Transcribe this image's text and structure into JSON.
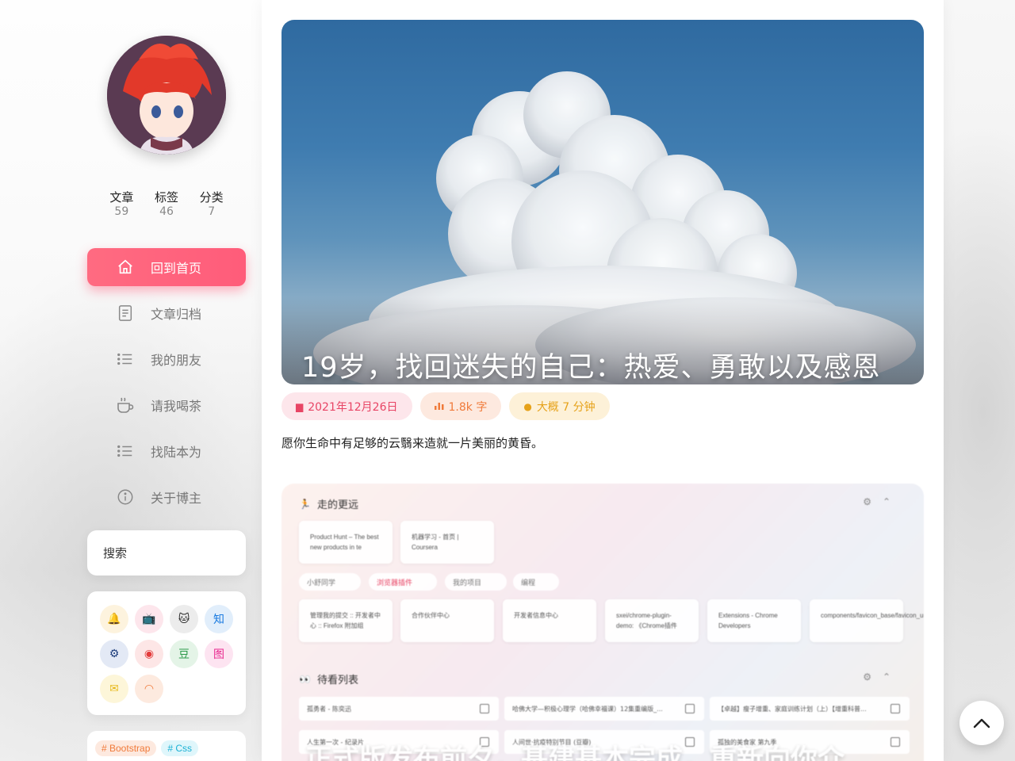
{
  "profile": {
    "stats": [
      {
        "label": "文章",
        "value": "59"
      },
      {
        "label": "标签",
        "value": "46"
      },
      {
        "label": "分类",
        "value": "7"
      }
    ]
  },
  "nav": {
    "items": [
      {
        "label": "回到首页",
        "icon": "home-icon",
        "active": true
      },
      {
        "label": "文章归档",
        "icon": "archive-icon"
      },
      {
        "label": "我的朋友",
        "icon": "list-icon"
      },
      {
        "label": "请我喝茶",
        "icon": "tea-cup-icon"
      },
      {
        "label": "找陆本为",
        "icon": "list-icon"
      },
      {
        "label": "关于博主",
        "icon": "info-icon"
      }
    ]
  },
  "search": {
    "placeholder": "搜索"
  },
  "social": [
    {
      "icon": "qq-bell-icon",
      "glyph": "🔔",
      "bg": "#fdf3de",
      "color": "#e6a21a"
    },
    {
      "icon": "bilibili-icon",
      "glyph": "📺",
      "bg": "#fde6ec",
      "color": "#f05a7e"
    },
    {
      "icon": "github-icon",
      "glyph": "🐱",
      "bg": "#ececec",
      "color": "#222"
    },
    {
      "icon": "zhihu-icon",
      "glyph": "知",
      "bg": "#e1eefb",
      "color": "#1a7be0"
    },
    {
      "icon": "steam-icon",
      "glyph": "⚙",
      "bg": "#e3e9f5",
      "color": "#1b3b7a"
    },
    {
      "icon": "weibo-icon",
      "glyph": "◉",
      "bg": "#fde6e6",
      "color": "#e33b3b"
    },
    {
      "icon": "douban-icon",
      "glyph": "豆",
      "bg": "#e4f4e7",
      "color": "#2c9a4a"
    },
    {
      "icon": "picture-icon",
      "glyph": "图",
      "bg": "#fde4f1",
      "color": "#e8288f"
    },
    {
      "icon": "ticket-icon",
      "glyph": "✉",
      "bg": "#fdf6d9",
      "color": "#e6b81a"
    },
    {
      "icon": "rss-icon",
      "glyph": "◠",
      "bg": "#fdeadf",
      "color": "#f07a3a"
    }
  ],
  "tags": [
    {
      "label": "# Bootstrap",
      "bg": "#fde9df",
      "color": "#f07a3a"
    },
    {
      "label": "# Css",
      "bg": "#dff6fb",
      "color": "#19b0d4"
    }
  ],
  "post1": {
    "title": "19岁，找回迷失的自己：热爱、勇敢以及感恩",
    "date": "2021年12月26日",
    "words": "1.8k 字",
    "read_time": "大概 7 分钟",
    "excerpt": "愿你生命中有足够的云翳来造就一片美丽的黄昏。"
  },
  "post2": {
    "title": "正式版发布前夕，基建基本完成，重新向你介",
    "section1": "走的更远",
    "section2": "待看列表",
    "tiles_top": [
      "Product Hunt – The best new products in te",
      "机器学习 - 首页 | Coursera"
    ],
    "pills": [
      "小舒同学",
      "浏览器插件",
      "我的项目",
      "编程"
    ],
    "tiles_mid": [
      "管理我的提交 :: 开发者中心 :: Firefox 附加组",
      "合作伙伴中心",
      "开发者信息中心",
      "sxei/chrome-plugin-demo: 《Chrome插件",
      "Extensions - Chrome Developers",
      "components/favicon_base/favicon_url_pars"
    ],
    "rows": [
      "孤勇者 - 陈奕迅",
      "哈佛大学—积极心理学（哈佛幸福课）12集重编版_...",
      "【卓越】瘦子增重、家庭训练计划（上）【增重科普...",
      "人生第一次 - 纪录片",
      "人间世·抗疫特别节目 (豆瓣)",
      "孤独的美食家 第九季"
    ]
  }
}
